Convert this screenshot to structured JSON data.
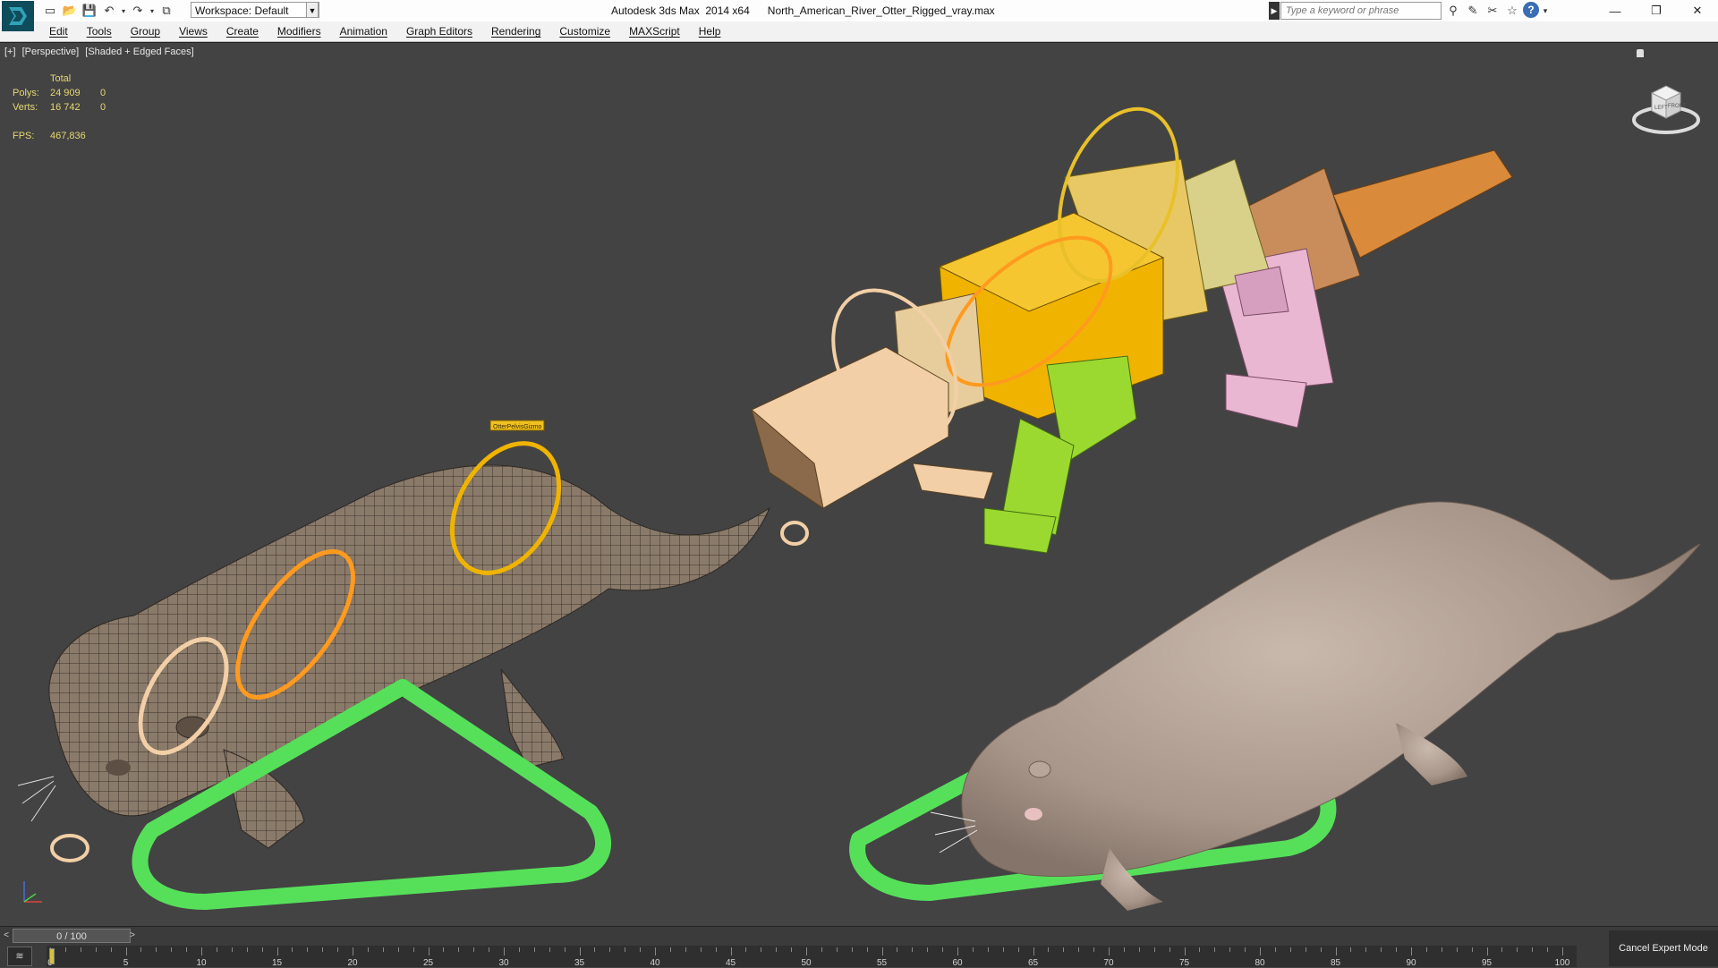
{
  "titlebar": {
    "workspace_label": "Workspace: Default",
    "app_title": "Autodesk 3ds Max  2014 x64",
    "file_name": "North_American_River_Otter_Rigged_vray.max",
    "search_placeholder": "Type a keyword or phrase"
  },
  "menu": {
    "items": [
      "Edit",
      "Tools",
      "Group",
      "Views",
      "Create",
      "Modifiers",
      "Animation",
      "Graph Editors",
      "Rendering",
      "Customize",
      "MAXScript",
      "Help"
    ]
  },
  "viewport": {
    "labels": [
      "[+]",
      "[Perspective]",
      "[Shaded + Edged Faces]"
    ],
    "stats": {
      "header": "Total",
      "polys_label": "Polys:",
      "polys_total": "24 909",
      "polys_sel": "0",
      "verts_label": "Verts:",
      "verts_total": "16 742",
      "verts_sel": "0",
      "fps_label": "FPS:",
      "fps_value": "467,836"
    },
    "gizmo_label": "OtterPelvisGizmo",
    "viewcube_faces": [
      "LEFT",
      "FRONT"
    ]
  },
  "timeline": {
    "frame_display": "0 / 100",
    "prev_arrow": "<",
    "next_arrow": ">",
    "ticks": [
      "0",
      "5",
      "10",
      "15",
      "20",
      "25",
      "30",
      "35",
      "40",
      "45",
      "50",
      "55",
      "60",
      "65",
      "70",
      "75",
      "80",
      "85",
      "90",
      "95",
      "100"
    ],
    "expert_mode_button": "Cancel Expert Mode"
  },
  "colors": {
    "viewport_bg": "#434343",
    "stats_text": "#e8d870",
    "rig_green": "#56e05a",
    "rig_yellow": "#f0b400",
    "rig_skin": "#f2cfa6",
    "rig_pink": "#e9b7d1",
    "rig_orange": "#d98a3a"
  }
}
